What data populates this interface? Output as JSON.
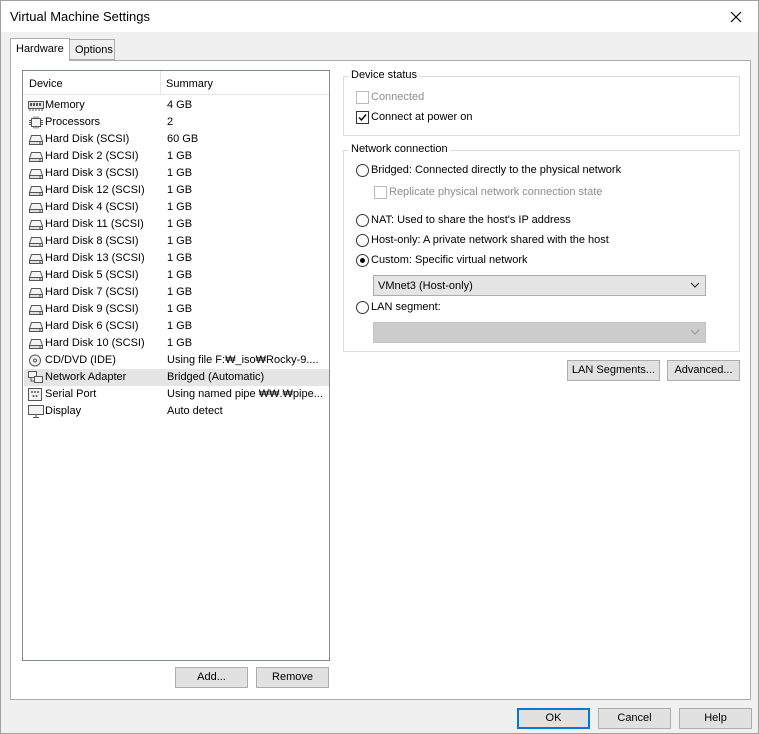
{
  "window": {
    "title": "Virtual Machine Settings"
  },
  "tabs": [
    {
      "label": "Hardware"
    },
    {
      "label": "Options"
    }
  ],
  "device_list": {
    "columns": {
      "device": "Device",
      "summary": "Summary"
    },
    "rows": [
      {
        "icon": "memory-icon",
        "name": "Memory",
        "summary": "4 GB"
      },
      {
        "icon": "processor-icon",
        "name": "Processors",
        "summary": "2"
      },
      {
        "icon": "hard-disk-icon",
        "name": "Hard Disk (SCSI)",
        "summary": "60 GB"
      },
      {
        "icon": "hard-disk-icon",
        "name": "Hard Disk 2 (SCSI)",
        "summary": "1 GB"
      },
      {
        "icon": "hard-disk-icon",
        "name": "Hard Disk 3 (SCSI)",
        "summary": "1 GB"
      },
      {
        "icon": "hard-disk-icon",
        "name": "Hard Disk 12 (SCSI)",
        "summary": "1 GB"
      },
      {
        "icon": "hard-disk-icon",
        "name": "Hard Disk 4 (SCSI)",
        "summary": "1 GB"
      },
      {
        "icon": "hard-disk-icon",
        "name": "Hard Disk 11 (SCSI)",
        "summary": "1 GB"
      },
      {
        "icon": "hard-disk-icon",
        "name": "Hard Disk 8 (SCSI)",
        "summary": "1 GB"
      },
      {
        "icon": "hard-disk-icon",
        "name": "Hard Disk 13 (SCSI)",
        "summary": "1 GB"
      },
      {
        "icon": "hard-disk-icon",
        "name": "Hard Disk 5 (SCSI)",
        "summary": "1 GB"
      },
      {
        "icon": "hard-disk-icon",
        "name": "Hard Disk 7 (SCSI)",
        "summary": "1 GB"
      },
      {
        "icon": "hard-disk-icon",
        "name": "Hard Disk 9 (SCSI)",
        "summary": "1 GB"
      },
      {
        "icon": "hard-disk-icon",
        "name": "Hard Disk 6 (SCSI)",
        "summary": "1 GB"
      },
      {
        "icon": "hard-disk-icon",
        "name": "Hard Disk 10 (SCSI)",
        "summary": "1 GB"
      },
      {
        "icon": "cd-dvd-icon",
        "name": "CD/DVD (IDE)",
        "summary": "Using file F:₩_iso₩Rocky-9...."
      },
      {
        "icon": "network-adapter-icon",
        "name": "Network Adapter",
        "summary": "Bridged (Automatic)",
        "selected": true
      },
      {
        "icon": "serial-port-icon",
        "name": "Serial Port",
        "summary": "Using named pipe ₩₩.₩pipe..."
      },
      {
        "icon": "display-icon",
        "name": "Display",
        "summary": "Auto detect"
      }
    ],
    "add_label": "Add...",
    "remove_label": "Remove"
  },
  "device_status": {
    "title": "Device status",
    "connected_label": "Connected",
    "connected_checked": false,
    "connect_power_label": "Connect at power on",
    "connect_power_checked": true
  },
  "network_connection": {
    "title": "Network connection",
    "bridged_label": "Bridged: Connected directly to the physical network",
    "replicate_label": "Replicate physical network connection state",
    "nat_label": "NAT: Used to share the host's IP address",
    "hostonly_label": "Host-only: A private network shared with the host",
    "custom_label": "Custom: Specific virtual network",
    "custom_value": "VMnet3 (Host-only)",
    "lan_label": "LAN segment:",
    "lan_value": "",
    "selected": "custom"
  },
  "buttons": {
    "lan_segments": "LAN Segments...",
    "advanced": "Advanced...",
    "ok": "OK",
    "cancel": "Cancel",
    "help": "Help"
  }
}
